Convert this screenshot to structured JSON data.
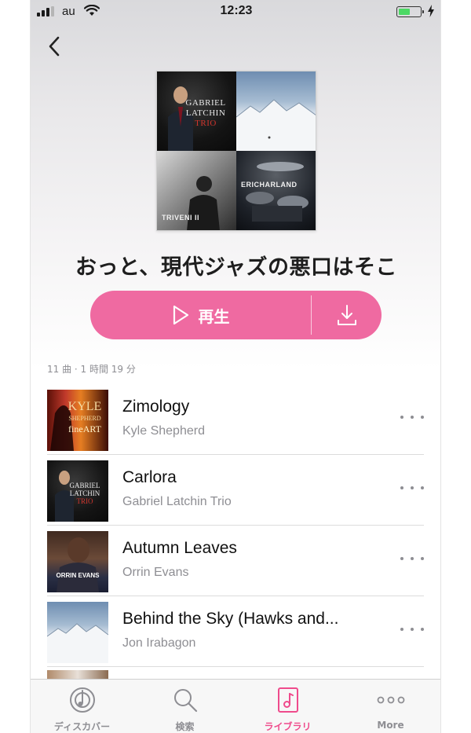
{
  "status_bar": {
    "carrier": "au",
    "time": "12:23",
    "battery_level": 0.55,
    "battery_color": "#4cd964"
  },
  "nav": {
    "back_icon": "chevron-left-icon"
  },
  "artwork": {
    "tile_1": {
      "line1": "GABRIEL",
      "line2": "LATCHIN",
      "line3": "TRIO"
    },
    "tile_3": {
      "line1": "TRIVENI II"
    },
    "tile_4": {
      "prefix": "ERIC",
      "suffix": "HARLAND"
    }
  },
  "playlist": {
    "title": "おっと、現代ジャズの悪口はそこ",
    "play_label": "再生",
    "play_icon": "play-icon",
    "download_icon": "download-icon",
    "meta": "11 曲 · 1 時間 19 分",
    "accent_color": "#ef6aa1"
  },
  "tracks": [
    {
      "title": "Zimology",
      "artist": "Kyle Shepherd",
      "art_line1": "KYLE",
      "art_line2": "SHEPHERD",
      "art_line3": "fineART"
    },
    {
      "title": "Carlora",
      "artist": "Gabriel Latchin Trio",
      "art_line1": "GABRIEL",
      "art_line2": "LATCHIN",
      "art_line3": "TRIO"
    },
    {
      "title": "Autumn Leaves",
      "artist": "Orrin Evans",
      "art_line1": "ORRIN EVANS",
      "art_line2": "",
      "art_line3": ""
    },
    {
      "title": "Behind the Sky (Hawks and...",
      "artist": "Jon Irabagon",
      "art_line1": "",
      "art_line2": "",
      "art_line3": ""
    }
  ],
  "tabbar": {
    "active_color": "#ef4b8c",
    "tabs": [
      {
        "label": "ディスカバー",
        "icon": "discover-icon",
        "active": false
      },
      {
        "label": "検索",
        "icon": "search-icon",
        "active": false
      },
      {
        "label": "ライブラリ",
        "icon": "library-icon",
        "active": true
      },
      {
        "label": "More",
        "icon": "more-icon",
        "active": false
      }
    ]
  }
}
